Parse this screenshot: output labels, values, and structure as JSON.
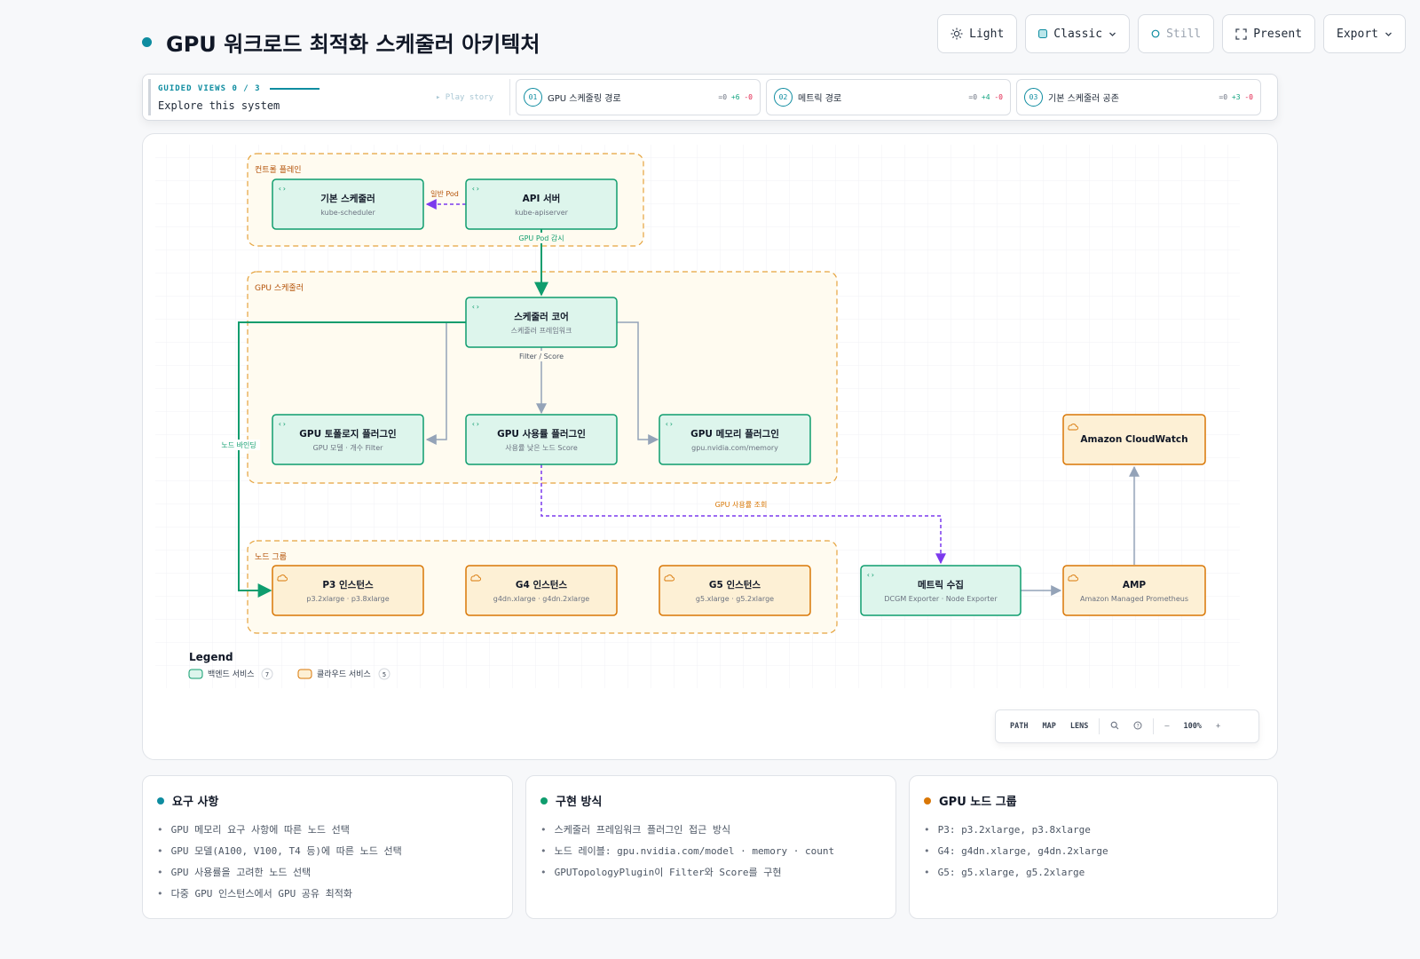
{
  "header": {
    "title": "GPU 워크로드 최적화 스케줄러 아키텍처"
  },
  "toolbar": {
    "light": "Light",
    "classic": "Classic",
    "still": "Still",
    "present": "Present",
    "export": "Export"
  },
  "story": {
    "label": "GUIDED VIEWS 0 / 3",
    "subtitle": "Explore this system",
    "play": "▸ Play story",
    "steps": [
      {
        "num": "01",
        "label": "GPU 스케줄링 경로",
        "eq": "=0",
        "plus": "+6",
        "minus": "-0"
      },
      {
        "num": "02",
        "label": "메트릭 경로",
        "eq": "=0",
        "plus": "+4",
        "minus": "-0"
      },
      {
        "num": "03",
        "label": "기본 스케줄러 공존",
        "eq": "=0",
        "plus": "+3",
        "minus": "-0"
      }
    ]
  },
  "diagram": {
    "groups": {
      "control_plane": "컨트롤 플레인",
      "gpu_scheduler": "GPU 스케줄러",
      "node_group": "노드 그룹"
    },
    "nodes": {
      "default_scheduler": {
        "title": "기본 스케줄러",
        "sub": "kube-scheduler"
      },
      "api_server": {
        "title": "API 서버",
        "sub": "kube-apiserver"
      },
      "scheduler_core": {
        "title": "스케줄러 코어",
        "sub": "스케줄러 프레임워크"
      },
      "topology_plugin": {
        "title": "GPU 토폴로지 플러그인",
        "sub": "GPU 모델 · 개수 Filter"
      },
      "usage_plugin": {
        "title": "GPU 사용률 플러그인",
        "sub": "사용률 낮은 노드 Score"
      },
      "memory_plugin": {
        "title": "GPU 메모리 플러그인",
        "sub": "gpu.nvidia.com/memory"
      },
      "p3": {
        "title": "P3 인스턴스",
        "sub": "p3.2xlarge · p3.8xlarge"
      },
      "g4": {
        "title": "G4 인스턴스",
        "sub": "g4dn.xlarge · g4dn.2xlarge"
      },
      "g5": {
        "title": "G5 인스턴스",
        "sub": "g5.xlarge · g5.2xlarge"
      },
      "metrics": {
        "title": "메트릭 수집",
        "sub": "DCGM Exporter · Node Exporter"
      },
      "amp": {
        "title": "AMP",
        "sub": "Amazon Managed Prometheus"
      },
      "cloudwatch": {
        "title": "Amazon CloudWatch"
      }
    },
    "edges": {
      "normal_pod": "일반 Pod",
      "watch_gpu_pod": "GPU Pod 감시",
      "filter_score": "Filter / Score",
      "node_binding": "노드 바인딩",
      "gpu_usage_query": "GPU 사용률 조회"
    },
    "legend": {
      "title": "Legend",
      "items": [
        {
          "label": "백엔드 서비스",
          "count": "7",
          "color": "#0f9d6e"
        },
        {
          "label": "클라우드 서비스",
          "count": "5",
          "color": "#d97706"
        }
      ]
    },
    "colors": {
      "backend": "#0f9d6e",
      "cloud": "#d97706",
      "accent": "#0e8ca0",
      "async": "#7c3aed"
    }
  },
  "controls": {
    "path": "PATH",
    "map": "MAP",
    "lens": "LENS",
    "zoom": "100%",
    "minus": "—",
    "plus": "+"
  },
  "cards": [
    {
      "title": "요구 사항",
      "color": "#0e8ca0",
      "items": [
        "GPU 메모리 요구 사항에 따른 노드 선택",
        "GPU 모델(A100, V100, T4 등)에 따른 노드 선택",
        "GPU 사용률을 고려한 노드 선택",
        "다중 GPU 인스턴스에서 GPU 공유 최적화"
      ]
    },
    {
      "title": "구현 방식",
      "color": "#0f9d6e",
      "items": [
        "스케줄러 프레임워크 플러그인 접근 방식",
        "노드 레이블: gpu.nvidia.com/model · memory · count",
        "GPUTopologyPlugin이 Filter와 Score를 구현"
      ]
    },
    {
      "title": "GPU 노드 그룹",
      "color": "#d97706",
      "items": [
        "P3: p3.2xlarge, p3.8xlarge",
        "G4: g4dn.xlarge, g4dn.2xlarge",
        "G5: g5.xlarge, g5.2xlarge"
      ]
    }
  ]
}
